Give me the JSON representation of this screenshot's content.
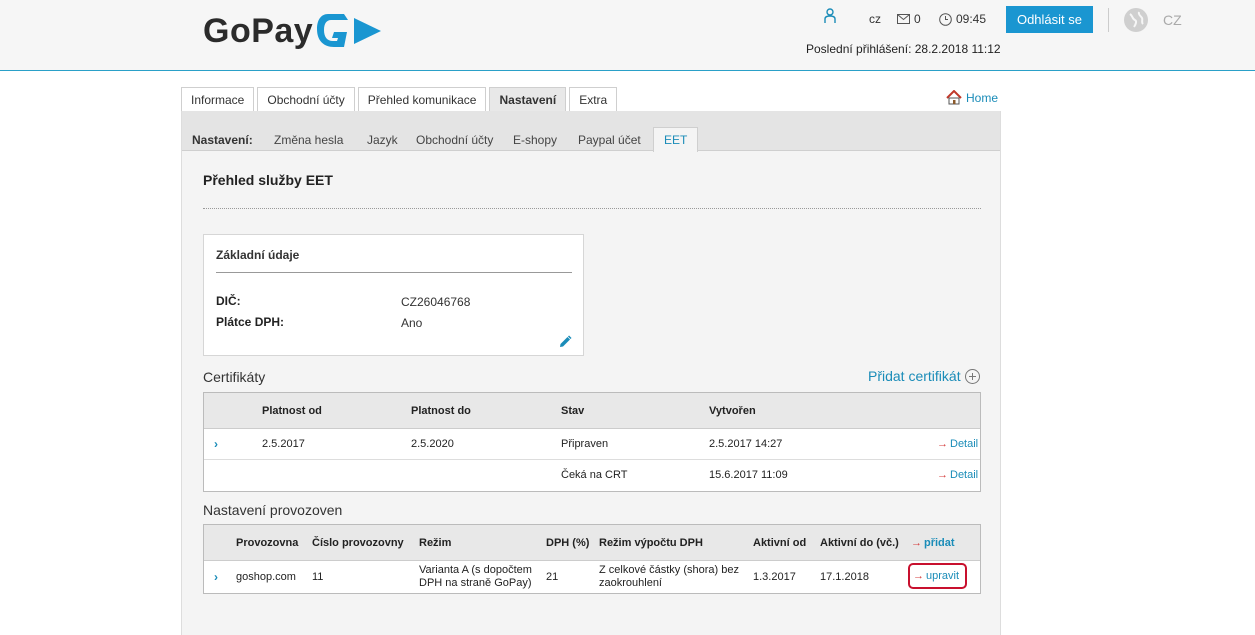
{
  "header": {
    "logo_text": "GoPay",
    "lang_code": "cz",
    "message_count": "0",
    "time": "09:45",
    "logout_label": "Odhlásit se",
    "language": "CZ",
    "last_login": "Poslední přihlášení: 28.2.2018 11:12",
    "accent": "#1a96d1"
  },
  "tabs": [
    {
      "label": "Informace"
    },
    {
      "label": "Obchodní účty"
    },
    {
      "label": "Přehled komunikace"
    },
    {
      "label": "Nastavení",
      "active": true
    },
    {
      "label": "Extra"
    }
  ],
  "home_label": "Home",
  "subnav": {
    "label": "Nastavení:",
    "items": [
      "Změna hesla",
      "Jazyk",
      "Obchodní účty",
      "E-shopy",
      "Paypal účet",
      "EET"
    ],
    "active": "EET"
  },
  "page_title": "Přehled služby EET",
  "basic_info": {
    "title": "Základní údaje",
    "dic_label": "DIČ:",
    "dic_value": "CZ26046768",
    "vat_label": "Plátce DPH:",
    "vat_value": "Ano"
  },
  "certificates": {
    "title": "Certifikáty",
    "add_label": "Přidat certifikát",
    "headers": [
      "Platnost od",
      "Platnost do",
      "Stav",
      "Vytvořen"
    ],
    "rows": [
      {
        "from": "2.5.2017",
        "to": "2.5.2020",
        "status": "Připraven",
        "created": "2.5.2017 14:27",
        "action": "Detail",
        "expandable": true
      },
      {
        "from": "",
        "to": "",
        "status": "Čeká na CRT",
        "created": "15.6.2017 11:09",
        "action": "Detail",
        "expandable": false
      }
    ]
  },
  "premises": {
    "title": "Nastavení provozoven",
    "headers": [
      "Provozovna",
      "Číslo provozovny",
      "Režim",
      "DPH (%)",
      "Režim výpočtu DPH",
      "Aktivní od",
      "Aktivní do (vč.)"
    ],
    "add_label": "přidat",
    "rows": [
      {
        "name": "goshop.com",
        "number": "11",
        "mode": "Varianta A (s dopočtem DPH na straně GoPay)",
        "vat": "21",
        "vat_mode": "Z celkové částky (shora) bez zaokrouhlení",
        "from": "1.3.2017",
        "to": "17.1.2018",
        "action": "upravit"
      }
    ]
  }
}
